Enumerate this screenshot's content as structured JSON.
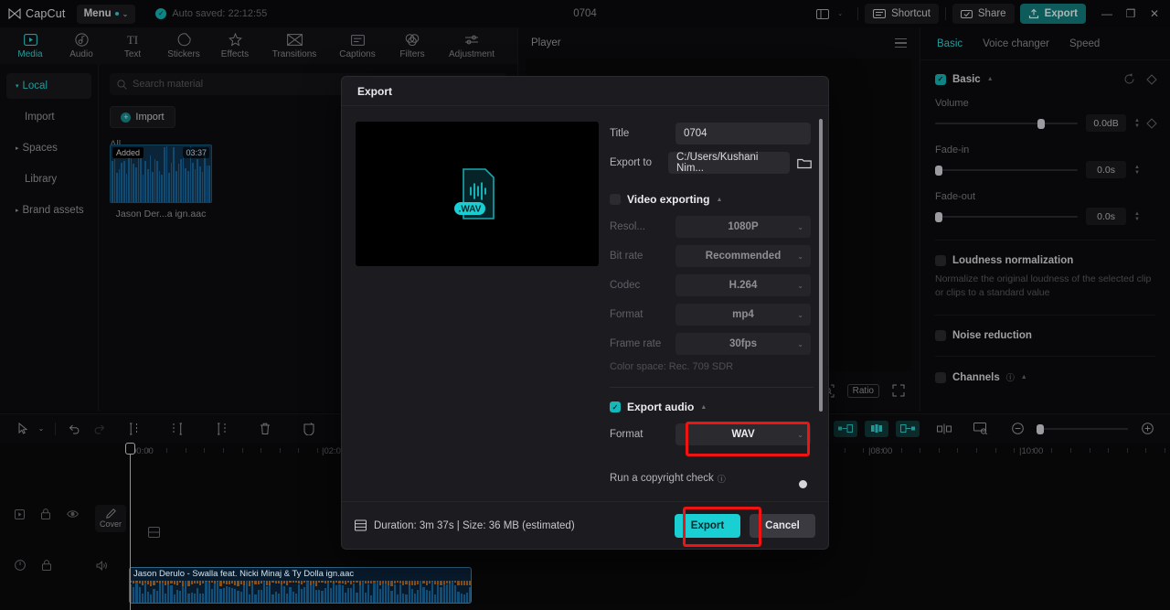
{
  "titlebar": {
    "app_name": "CapCut",
    "menu_label": "Menu",
    "autosave_text": "Auto saved: 22:12:55",
    "project_title": "0704",
    "shortcut_label": "Shortcut",
    "share_label": "Share",
    "export_label": "Export",
    "minimize": "—",
    "maximize": "❐",
    "close": "✕",
    "accent_teal": "#2fd5d5",
    "export_btn_bg": "#127e7e"
  },
  "topnav": {
    "tabs": [
      {
        "label": "Media",
        "icon": "media-icon",
        "active": true
      },
      {
        "label": "Audio",
        "icon": "audio-icon",
        "active": false
      },
      {
        "label": "Text",
        "icon": "text-icon",
        "active": false
      },
      {
        "label": "Stickers",
        "icon": "stickers-icon",
        "active": false
      },
      {
        "label": "Effects",
        "icon": "effects-icon",
        "active": false
      },
      {
        "label": "Transitions",
        "icon": "transitions-icon",
        "active": false
      },
      {
        "label": "Captions",
        "icon": "captions-icon",
        "active": false
      },
      {
        "label": "Filters",
        "icon": "filters-icon",
        "active": false
      },
      {
        "label": "Adjustment",
        "icon": "adjustment-icon",
        "active": false
      }
    ]
  },
  "leftbar": {
    "items": [
      {
        "label": "Local",
        "expandable": true,
        "active": true
      },
      {
        "label": "Import",
        "expandable": false,
        "active": false
      },
      {
        "label": "Spaces",
        "expandable": true,
        "active": false
      },
      {
        "label": "Library",
        "expandable": false,
        "active": false
      },
      {
        "label": "Brand assets",
        "expandable": true,
        "active": false
      }
    ]
  },
  "media": {
    "search_placeholder": "Search material",
    "import_label": "Import",
    "filter_label": "All",
    "card": {
      "badge": "Added",
      "duration": "03:37",
      "name": "Jason Der...a ign.aac"
    }
  },
  "player": {
    "title": "Player",
    "ratio_label": "Ratio"
  },
  "rightpanel": {
    "tabs": [
      {
        "label": "Basic",
        "active": true
      },
      {
        "label": "Voice changer",
        "active": false
      },
      {
        "label": "Speed",
        "active": false
      }
    ],
    "basic": {
      "section_label": "Basic",
      "checked": true,
      "volume_label": "Volume",
      "volume_value": "0.0dB",
      "fade_in_label": "Fade-in",
      "fade_in_value": "0.0s",
      "fade_out_label": "Fade-out",
      "fade_out_value": "0.0s"
    },
    "loudness": {
      "label": "Loudness normalization",
      "checked": false,
      "help": "Normalize the original loudness of the selected clip or clips to a standard value"
    },
    "noise": {
      "label": "Noise reduction",
      "checked": false
    },
    "channels": {
      "label": "Channels",
      "checked": false
    }
  },
  "timeline_toolbar": {
    "left_icons": [
      "cursor-icon",
      "chevron-down-icon",
      "undo-icon",
      "redo-icon",
      "split-icon",
      "trim-left-icon",
      "trim-right-icon",
      "delete-icon",
      "freeze-icon",
      "mask-icon"
    ],
    "right_icons": [
      "microphone-icon",
      "keyframe-prev-icon",
      "keyframe-add-icon",
      "keyframe-next-icon",
      "mirror-icon",
      "crop-icon",
      "zoom-out-icon",
      "zoom-in-icon"
    ]
  },
  "timeline": {
    "ruler_labels": [
      "00:00",
      "02:00",
      "08:00",
      "10:00"
    ],
    "cover_label": "Cover",
    "playhead_time": "00:00",
    "audio_clip_label": "Jason Derulo - Swalla feat. Nicki Minaj & Ty Dolla ign.aac"
  },
  "export_dialog": {
    "title": "Export",
    "fields": {
      "title_label": "Title",
      "title_value": "0704",
      "export_to_label": "Export to",
      "export_to_value": "C:/Users/Kushani Nim...",
      "folder_icon": "folder-icon"
    },
    "video_section": {
      "label": "Video exporting",
      "checked": false,
      "rows": [
        {
          "label": "Resol...",
          "value": "1080P"
        },
        {
          "label": "Bit rate",
          "value": "Recommended"
        },
        {
          "label": "Codec",
          "value": "H.264"
        },
        {
          "label": "Format",
          "value": "mp4"
        },
        {
          "label": "Frame rate",
          "value": "30fps"
        }
      ],
      "colorspace": "Color space: Rec. 709 SDR"
    },
    "audio_section": {
      "label": "Export audio",
      "checked": true,
      "format_label": "Format",
      "format_value": "WAV",
      "highlighted": true
    },
    "copyright": {
      "label": "Run a copyright check",
      "info_icon": "info-icon",
      "enabled": false
    },
    "preview": {
      "file_type_badge": ".WAV"
    },
    "footer": {
      "duration_size": "Duration: 3m 37s | Size: 36 MB (estimated)",
      "export_label": "Export",
      "cancel_label": "Cancel",
      "export_highlighted": true
    },
    "highlight_color": "#ef1414"
  }
}
